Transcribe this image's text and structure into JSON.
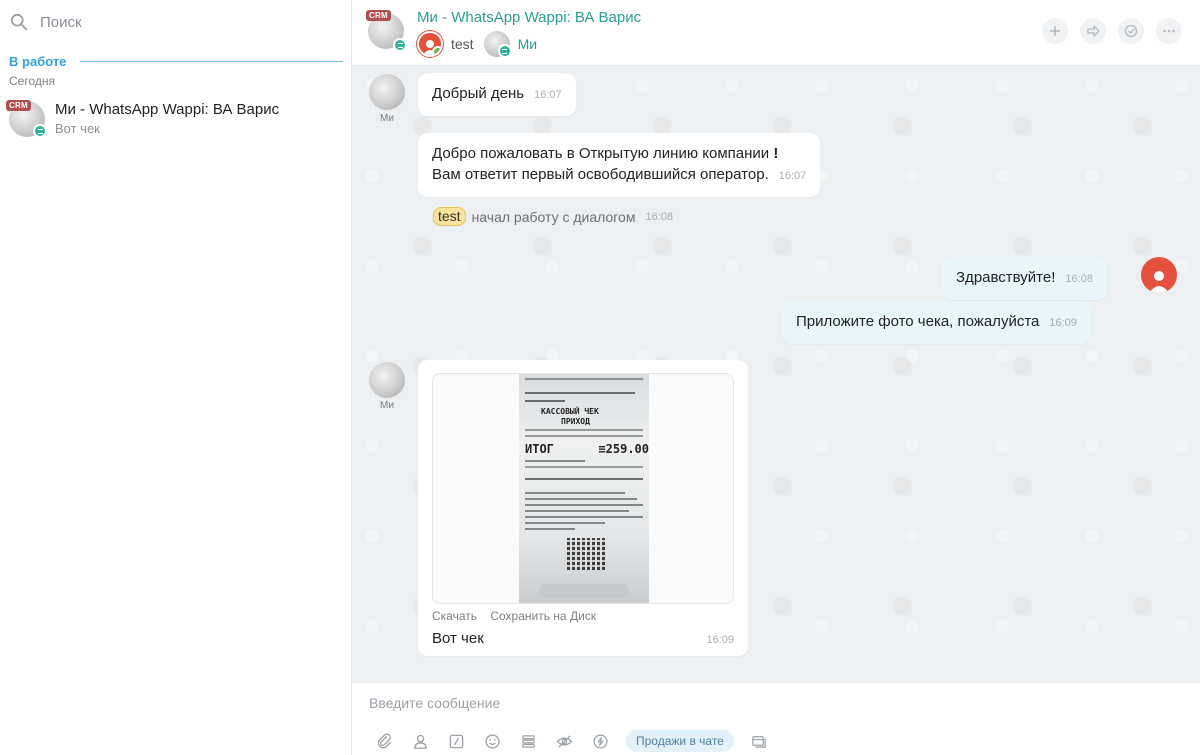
{
  "sidebar": {
    "search_placeholder": "Поиск",
    "section_title": "В работе",
    "day_label": "Сегодня",
    "chat": {
      "crm_badge": "CRM",
      "name": "Ми - WhatsApp Wappi: ВА Варис",
      "preview": "Вот чек"
    }
  },
  "header": {
    "crm_badge": "CRM",
    "title": "Ми - WhatsApp Wappi: ВА Варис",
    "participants": [
      {
        "name": "test"
      },
      {
        "name": "Ми"
      }
    ]
  },
  "messages": {
    "m1": {
      "author": "Ми",
      "text": "Добрый день",
      "time": "16:07"
    },
    "m2": {
      "line1_a": "Добро пожаловать в Открытую линию компании ",
      "line1_b": "!",
      "line2": "Вам ответит первый освободившийся оператор.",
      "time": "16:07"
    },
    "system": {
      "tag": "test",
      "text": "начал работу с диалогом",
      "time": "16:08"
    },
    "m3": {
      "text": "Здравствуйте!",
      "time": "16:08"
    },
    "m4": {
      "text": "Приложите фото чека, пожалуйста",
      "time": "16:09"
    },
    "m5": {
      "author": "Ми",
      "download": "Скачать",
      "save_disk": "Сохранить на Диск",
      "text": "Вот чек",
      "time": "16:09"
    },
    "receipt": {
      "title": "КАССОВЫЙ ЧЕК",
      "sub": "ПРИХОД",
      "total_label": "ИТОГ",
      "total_value": "≡259.00"
    }
  },
  "composer": {
    "placeholder": "Введите сообщение",
    "sales_button": "Продажи в чате"
  },
  "colors": {
    "accent_teal": "#2a9e8e",
    "accent_blue": "#2fa4d8",
    "crm_badge": "#b04d4d",
    "operator_avatar": "#e5513d",
    "outgoing_bubble": "#e8f6fc"
  }
}
